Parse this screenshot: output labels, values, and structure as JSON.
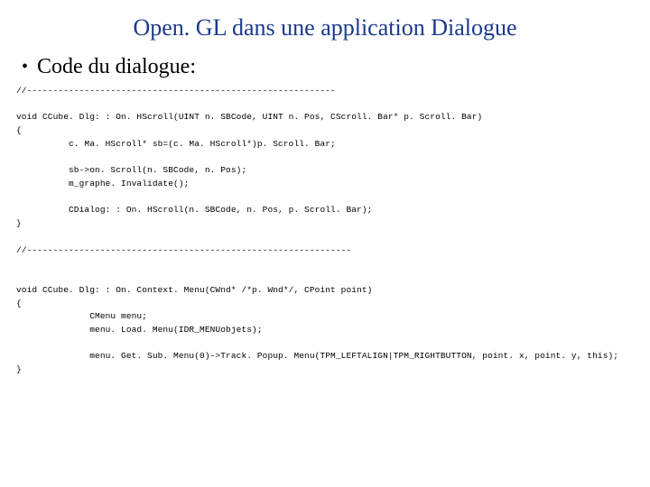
{
  "title": "Open. GL dans une application Dialogue",
  "bullet": "Code du dialogue:",
  "code_lines": [
    "//-----------------------------------------------------------",
    "",
    "void CCube. Dlg: : On. HScroll(UINT n. SBCode, UINT n. Pos, CScroll. Bar* p. Scroll. Bar)",
    "{",
    "          c. Ma. HScroll* sb=(c. Ma. HScroll*)p. Scroll. Bar;",
    "",
    "          sb->on. Scroll(n. SBCode, n. Pos);",
    "          m_graphe. Invalidate();",
    "",
    "          CDialog: : On. HScroll(n. SBCode, n. Pos, p. Scroll. Bar);",
    "}",
    "",
    "//--------------------------------------------------------------",
    "",
    "",
    "void CCube. Dlg: : On. Context. Menu(CWnd* /*p. Wnd*/, CPoint point)",
    "{",
    "              CMenu menu;",
    "              menu. Load. Menu(IDR_MENUobjets);",
    "",
    "              menu. Get. Sub. Menu(0)->Track. Popup. Menu(TPM_LEFTALIGN|TPM_RIGHTBUTTON, point. x, point. y, this);",
    "}"
  ]
}
